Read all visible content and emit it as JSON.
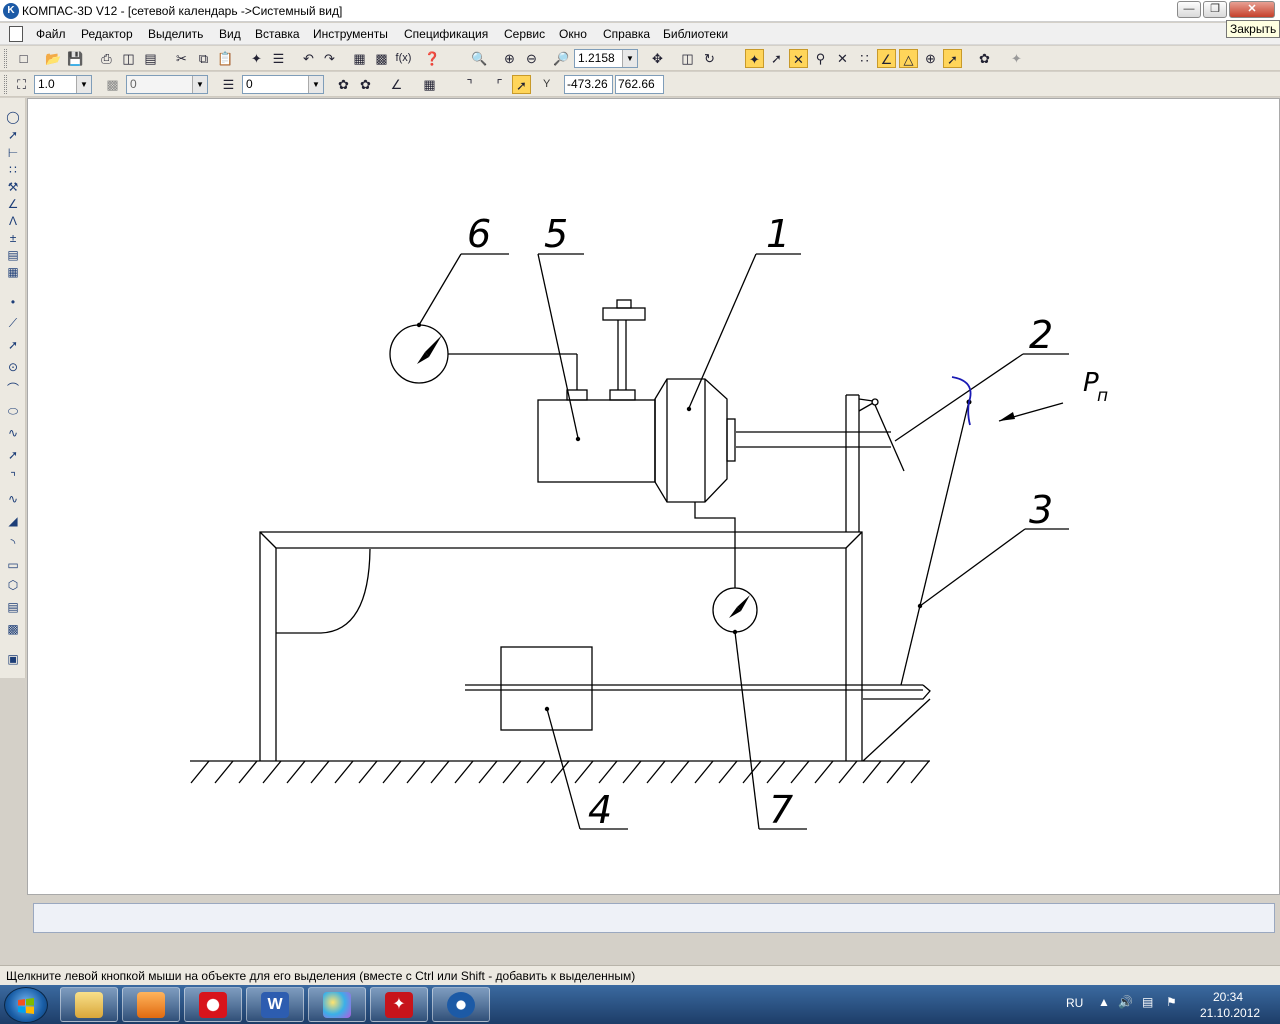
{
  "window": {
    "title": "КОМПАС-3D V12 - [сетевой календарь ->Системный вид]",
    "app_icon": "kompas-logo-icon",
    "tooltip": "Закрыть"
  },
  "menu": [
    "Файл",
    "Редактор",
    "Выделить",
    "Вид",
    "Вставка",
    "Инструменты",
    "Спецификация",
    "Сервис",
    "Окно",
    "Справка",
    "Библиотеки"
  ],
  "toolbar1": {
    "zoom_value": "1.2158"
  },
  "toolbar2": {
    "line_scale": "1.0",
    "layer_state": "0",
    "current_layer": "0",
    "coord_x": "-473.26",
    "coord_y": "762.66",
    "coord_label": "Y"
  },
  "drawing": {
    "labels": [
      "1",
      "2",
      "3",
      "4",
      "5",
      "6",
      "7"
    ],
    "force_label": "P",
    "force_subscript": "п"
  },
  "status": {
    "hint": "Щелкните левой кнопкой мыши на объекте для его выделения (вместе с Ctrl или Shift - добавить к выделенным)"
  },
  "taskbar": {
    "apps": [
      "explorer-icon",
      "media-player-icon",
      "opera-icon",
      "word-icon",
      "paint-icon",
      "acrobat-icon",
      "kompas-icon"
    ],
    "language": "RU",
    "time": "20:34",
    "date": "21.10.2012"
  },
  "colors": {
    "curve_blue": "#1a1ab4",
    "taskbar": "#1d3d68"
  }
}
